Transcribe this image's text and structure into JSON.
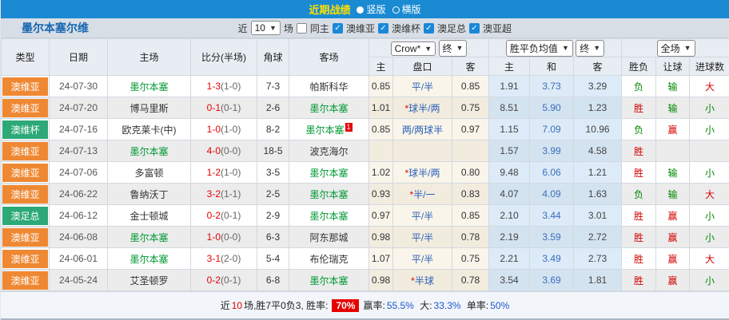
{
  "title_bar": {
    "title": "近期战绩",
    "radio_vertical": "竖版",
    "radio_horizontal": "横版"
  },
  "controls": {
    "team_name": "墨尔本塞尔维",
    "near_label": "近",
    "matches_value": "10",
    "matches_label": "场",
    "same_host_label": "同主",
    "leagues": [
      "澳维亚",
      "澳维杯",
      "澳足总",
      "澳亚超"
    ]
  },
  "table": {
    "headers_left": [
      "类型",
      "日期",
      "主场",
      "比分(半场)",
      "角球",
      "客场"
    ],
    "dropdowns": {
      "odds_source": "Crow*",
      "odds_time": "终",
      "avg_label": "胜平负均值",
      "avg_time": "终",
      "scope": "全场"
    },
    "subheaders": [
      "主",
      "盘口",
      "客",
      "主",
      "和",
      "客",
      "胜负",
      "让球",
      "进球数"
    ],
    "rows": [
      {
        "league": "澳维亚",
        "league_color": "o",
        "date": "24-07-30",
        "home": "墨尔本塞",
        "home_team": true,
        "ft": "1-3",
        "ht": "(1-0)",
        "corner": "7-3",
        "away": "帕斯科华",
        "away_team": false,
        "sup": "",
        "crow_home": "0.85",
        "star": false,
        "handicap": "平/半",
        "crow_away": "0.85",
        "avg_home": "1.91",
        "avg_draw": "3.73",
        "avg_away": "3.29",
        "wdl": "负",
        "wdl_c": "g",
        "hc_res": "输",
        "hc_c": "g",
        "goal": "大",
        "goal_c": "r"
      },
      {
        "league": "澳维亚",
        "league_color": "o",
        "date": "24-07-20",
        "home": "博马里斯",
        "home_team": false,
        "ft": "0-1",
        "ht": "(0-1)",
        "corner": "2-6",
        "away": "墨尔本塞",
        "away_team": true,
        "sup": "",
        "crow_home": "1.01",
        "star": true,
        "handicap": "球半/两",
        "crow_away": "0.75",
        "avg_home": "8.51",
        "avg_draw": "5.90",
        "avg_away": "1.23",
        "wdl": "胜",
        "wdl_c": "r",
        "hc_res": "输",
        "hc_c": "g",
        "goal": "小",
        "goal_c": "g"
      },
      {
        "league": "澳维杯",
        "league_color": "g",
        "date": "24-07-16",
        "home": "欧克莱卡(中)",
        "home_team": false,
        "ft": "1-0",
        "ht": "(1-0)",
        "corner": "8-2",
        "away": "墨尔本塞",
        "away_team": true,
        "sup": "1",
        "crow_home": "0.85",
        "star": false,
        "handicap": "两/两球半",
        "crow_away": "0.97",
        "avg_home": "1.15",
        "avg_draw": "7.09",
        "avg_away": "10.96",
        "wdl": "负",
        "wdl_c": "g",
        "hc_res": "赢",
        "hc_c": "r",
        "goal": "小",
        "goal_c": "g"
      },
      {
        "league": "澳维亚",
        "league_color": "o",
        "date": "24-07-13",
        "home": "墨尔本塞",
        "home_team": true,
        "ft": "4-0",
        "ht": "(0-0)",
        "corner": "18-5",
        "away": "波克海尔",
        "away_team": false,
        "sup": "",
        "crow_home": "",
        "star": false,
        "handicap": "",
        "crow_away": "",
        "avg_home": "1.57",
        "avg_draw": "3.99",
        "avg_away": "4.58",
        "wdl": "胜",
        "wdl_c": "r",
        "hc_res": "",
        "hc_c": "g",
        "goal": "",
        "goal_c": "g"
      },
      {
        "league": "澳维亚",
        "league_color": "o",
        "date": "24-07-06",
        "home": "多富顿",
        "home_team": false,
        "ft": "1-2",
        "ht": "(1-0)",
        "corner": "3-5",
        "away": "墨尔本塞",
        "away_team": true,
        "sup": "",
        "crow_home": "1.02",
        "star": true,
        "handicap": "球半/两",
        "crow_away": "0.80",
        "avg_home": "9.48",
        "avg_draw": "6.06",
        "avg_away": "1.21",
        "wdl": "胜",
        "wdl_c": "r",
        "hc_res": "输",
        "hc_c": "g",
        "goal": "小",
        "goal_c": "g"
      },
      {
        "league": "澳维亚",
        "league_color": "o",
        "date": "24-06-22",
        "home": "鲁纳沃丁",
        "home_team": false,
        "ft": "3-2",
        "ht": "(1-1)",
        "corner": "2-5",
        "away": "墨尔本塞",
        "away_team": true,
        "sup": "",
        "crow_home": "0.93",
        "star": true,
        "handicap": "半/一",
        "crow_away": "0.83",
        "avg_home": "4.07",
        "avg_draw": "4.09",
        "avg_away": "1.63",
        "wdl": "负",
        "wdl_c": "g",
        "hc_res": "输",
        "hc_c": "g",
        "goal": "大",
        "goal_c": "r"
      },
      {
        "league": "澳足总",
        "league_color": "g",
        "date": "24-06-12",
        "home": "金士顿城",
        "home_team": false,
        "ft": "0-2",
        "ht": "(0-1)",
        "corner": "2-9",
        "away": "墨尔本塞",
        "away_team": true,
        "sup": "",
        "crow_home": "0.97",
        "star": false,
        "handicap": "平/半",
        "crow_away": "0.85",
        "avg_home": "2.10",
        "avg_draw": "3.44",
        "avg_away": "3.01",
        "wdl": "胜",
        "wdl_c": "r",
        "hc_res": "赢",
        "hc_c": "r",
        "goal": "小",
        "goal_c": "g"
      },
      {
        "league": "澳维亚",
        "league_color": "o",
        "date": "24-06-08",
        "home": "墨尔本塞",
        "home_team": true,
        "ft": "1-0",
        "ht": "(0-0)",
        "corner": "6-3",
        "away": "阿东那城",
        "away_team": false,
        "sup": "",
        "crow_home": "0.98",
        "star": false,
        "handicap": "平/半",
        "crow_away": "0.78",
        "avg_home": "2.19",
        "avg_draw": "3.59",
        "avg_away": "2.72",
        "wdl": "胜",
        "wdl_c": "r",
        "hc_res": "赢",
        "hc_c": "r",
        "goal": "小",
        "goal_c": "g"
      },
      {
        "league": "澳维亚",
        "league_color": "o",
        "date": "24-06-01",
        "home": "墨尔本塞",
        "home_team": true,
        "ft": "3-1",
        "ht": "(2-0)",
        "corner": "5-4",
        "away": "布伦瑞克",
        "away_team": false,
        "sup": "",
        "crow_home": "1.07",
        "star": false,
        "handicap": "平/半",
        "crow_away": "0.75",
        "avg_home": "2.21",
        "avg_draw": "3.49",
        "avg_away": "2.73",
        "wdl": "胜",
        "wdl_c": "r",
        "hc_res": "赢",
        "hc_c": "r",
        "goal": "大",
        "goal_c": "r"
      },
      {
        "league": "澳维亚",
        "league_color": "o",
        "date": "24-05-24",
        "home": "艾圣顿罗",
        "home_team": false,
        "ft": "0-2",
        "ht": "(0-1)",
        "corner": "6-8",
        "away": "墨尔本塞",
        "away_team": true,
        "sup": "",
        "crow_home": "0.98",
        "star": true,
        "handicap": "半球",
        "crow_away": "0.78",
        "avg_home": "3.54",
        "avg_draw": "3.69",
        "avg_away": "1.81",
        "wdl": "胜",
        "wdl_c": "r",
        "hc_res": "赢",
        "hc_c": "r",
        "goal": "小",
        "goal_c": "g"
      }
    ]
  },
  "footer": {
    "prefix": "近",
    "count": "10",
    "mid": "场,胜7平0负3, 胜率:",
    "win_rate": "70%",
    "label_win": "赢率:",
    "val_win": "55.5%",
    "label_big": "大:",
    "val_big": "33.3%",
    "label_single": "单率:",
    "val_single": "50%"
  },
  "colors": {
    "bar_blue": "#1a8ad2",
    "badge_orange": "#ef8833",
    "badge_green": "#2ca977",
    "team_green": "#009933",
    "score_red": "#e60000",
    "handicap_blue": "#2d62b8"
  }
}
